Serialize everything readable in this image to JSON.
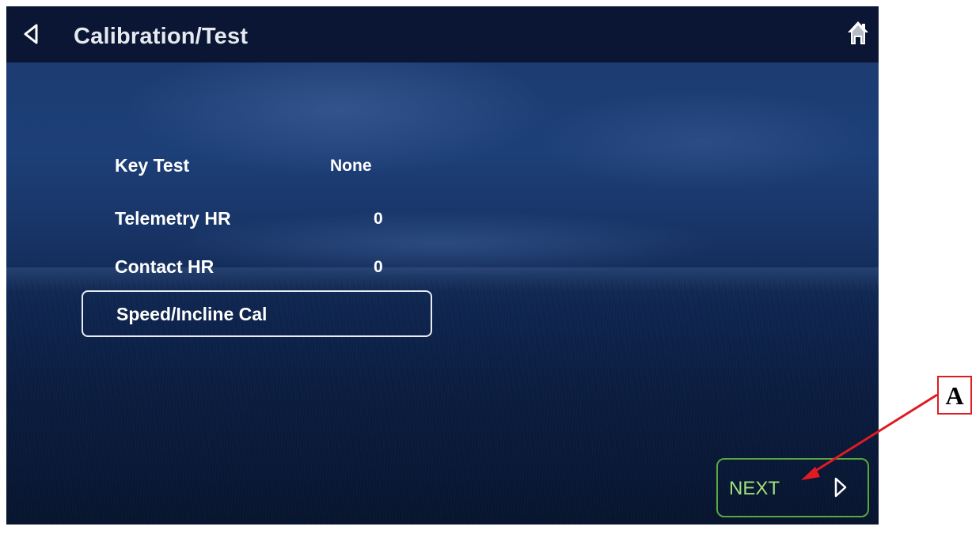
{
  "header": {
    "title": "Calibration/Test",
    "back_icon": "back-arrow-icon",
    "home_icon": "home-icon"
  },
  "rows": [
    {
      "label": "Key Test",
      "value": "None"
    },
    {
      "label": "Telemetry HR",
      "value": "0"
    },
    {
      "label": "Contact HR",
      "value": "0"
    }
  ],
  "speed_incline_button": {
    "label": "Speed/Incline Cal"
  },
  "next_button": {
    "label": "NEXT",
    "icon": "chevron-right-icon"
  },
  "annotation": {
    "letter": "A"
  },
  "colors": {
    "header_bg": "#0a1633",
    "text": "#ffffff",
    "next_border": "#5aa640",
    "next_text": "#9fe07a",
    "annotation_red": "#e01b23"
  }
}
